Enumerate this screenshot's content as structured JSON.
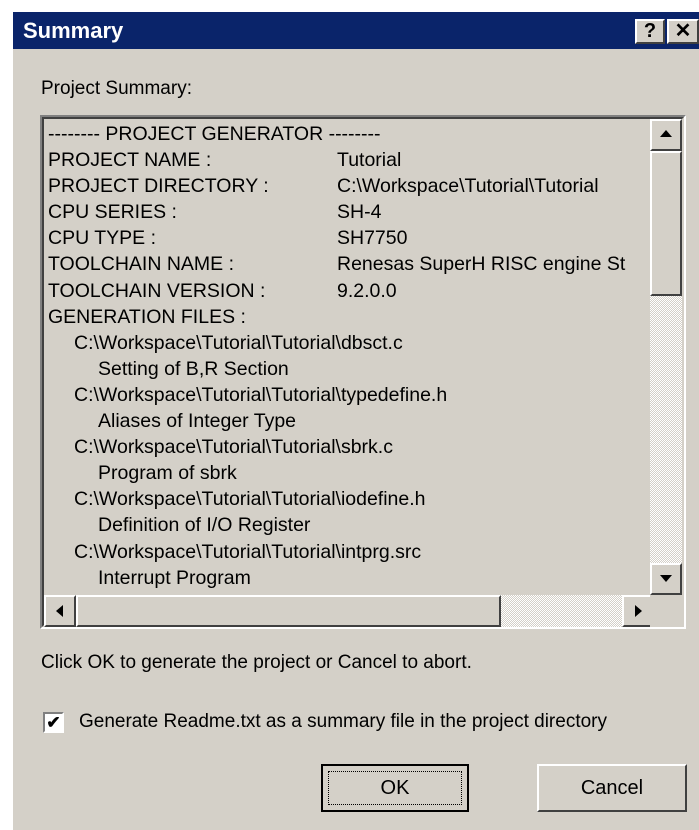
{
  "window": {
    "title": "Summary",
    "help_glyph": "?",
    "close_glyph": "✕"
  },
  "label_summary": "Project Summary:",
  "summary": {
    "header": "-------- PROJECT GENERATOR --------",
    "fields": [
      {
        "key": "PROJECT NAME :",
        "value": "Tutorial"
      },
      {
        "key": "PROJECT DIRECTORY :",
        "value": "C:\\Workspace\\Tutorial\\Tutorial"
      },
      {
        "key": "CPU SERIES :",
        "value": "SH-4"
      },
      {
        "key": "CPU TYPE :",
        "value": "SH7750"
      },
      {
        "key": "TOOLCHAIN NAME :",
        "value": "Renesas SuperH RISC engine St"
      },
      {
        "key": "TOOLCHAIN VERSION :",
        "value": "9.2.0.0"
      }
    ],
    "files_header": "GENERATION FILES :",
    "files": [
      {
        "path": "C:\\Workspace\\Tutorial\\Tutorial\\dbsct.c",
        "desc": "Setting of B,R Section"
      },
      {
        "path": "C:\\Workspace\\Tutorial\\Tutorial\\typedefine.h",
        "desc": "Aliases of Integer Type"
      },
      {
        "path": "C:\\Workspace\\Tutorial\\Tutorial\\sbrk.c",
        "desc": "Program of sbrk"
      },
      {
        "path": "C:\\Workspace\\Tutorial\\Tutorial\\iodefine.h",
        "desc": "Definition of I/O Register"
      },
      {
        "path": "C:\\Workspace\\Tutorial\\Tutorial\\intprg.src",
        "desc": "Interrupt Program"
      }
    ]
  },
  "instruction": "Click OK to generate the project or Cancel to abort.",
  "readme_checkbox": {
    "checked": true,
    "mark": "✔",
    "label": "Generate Readme.txt as a summary file in the project directory"
  },
  "buttons": {
    "ok": "OK",
    "cancel": "Cancel"
  },
  "colors": {
    "titlebar": "#0a246a",
    "dialog_bg": "#d4d0c8"
  }
}
